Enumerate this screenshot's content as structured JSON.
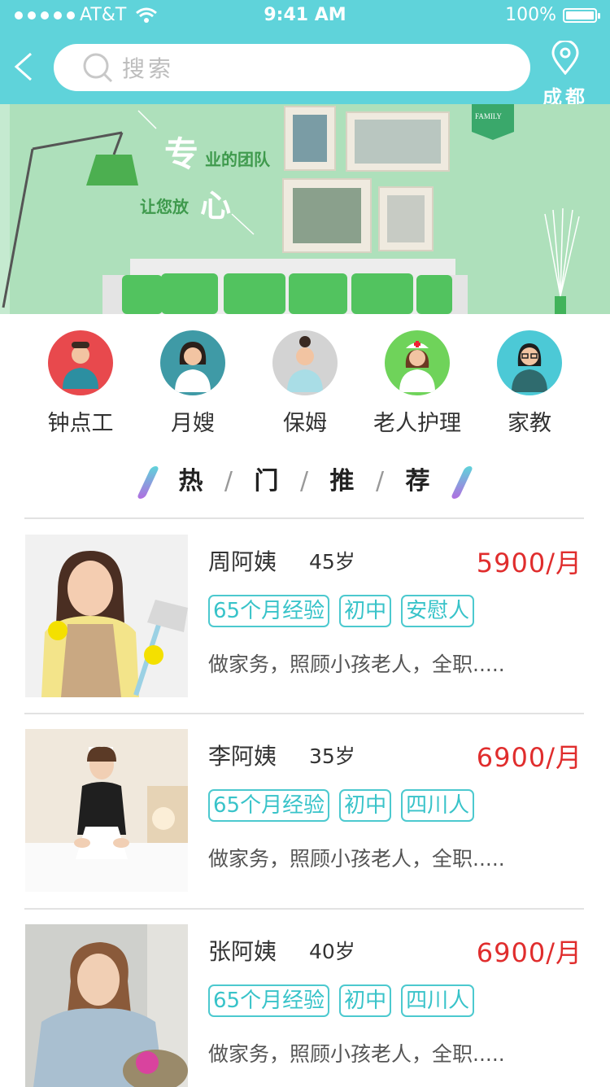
{
  "status_bar": {
    "carrier": "AT&T",
    "time": "9:41 AM",
    "battery": "100%"
  },
  "header": {
    "search_placeholder": "搜索",
    "location": "成都"
  },
  "banner": {
    "headline_big1": "专",
    "headline_small1": "业的团队",
    "headline_small2": "让您放",
    "headline_big2": "心",
    "family_badge": "FAMILY"
  },
  "categories": [
    {
      "label": "钟点工",
      "icon": "hourly-worker-avatar-icon",
      "color": "#e8494d"
    },
    {
      "label": "月嫂",
      "icon": "maternity-nanny-avatar-icon",
      "color": "#3f9aa6"
    },
    {
      "label": "保姆",
      "icon": "nanny-avatar-icon",
      "color": "#d3d3d3"
    },
    {
      "label": "老人护理",
      "icon": "elderly-care-nurse-avatar-icon",
      "color": "#6fd35a"
    },
    {
      "label": "家教",
      "icon": "tutor-avatar-icon",
      "color": "#4cc9d6"
    }
  ],
  "section": {
    "c1": "热",
    "c2": "门",
    "c3": "推",
    "c4": "荐",
    "sep": "/"
  },
  "listings": [
    {
      "name": "周阿姨",
      "age": "45岁",
      "price": "5900/月",
      "tags": [
        "65个月经验",
        "初中",
        "安慰人"
      ],
      "desc": "做家务，照顾小孩老人，全职....."
    },
    {
      "name": "李阿姨",
      "age": "35岁",
      "price": "6900/月",
      "tags": [
        "65个月经验",
        "初中",
        "四川人"
      ],
      "desc": "做家务，照顾小孩老人，全职....."
    },
    {
      "name": "张阿姨",
      "age": "40岁",
      "price": "6900/月",
      "tags": [
        "65个月经验",
        "初中",
        "四川人"
      ],
      "desc": "做家务，照顾小孩老人，全职....."
    }
  ],
  "colors": {
    "accent": "#5fd3da",
    "price": "#e02d2d",
    "tag": "#4cc9cf"
  }
}
